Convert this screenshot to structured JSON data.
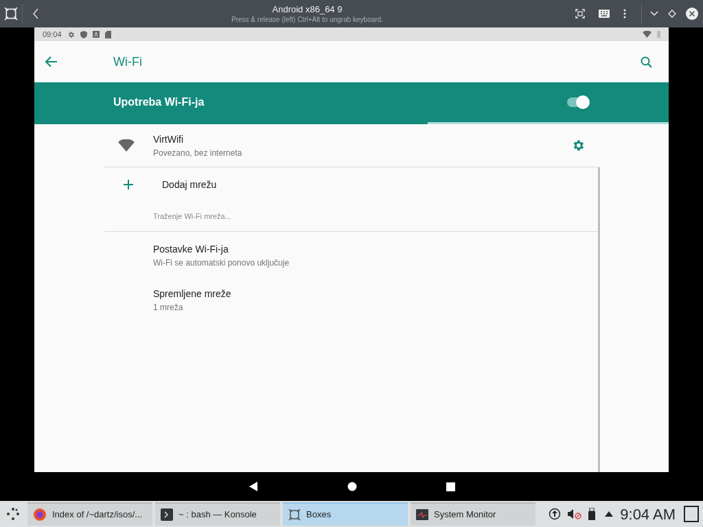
{
  "window": {
    "title": "Android x86_64 9",
    "subtitle": "Press & release (left) Ctrl+Alt to ungrab keyboard."
  },
  "status_bar": {
    "time": "09:04"
  },
  "app_bar": {
    "title": "Wi-Fi"
  },
  "master_switch": {
    "label": "Upotreba Wi-Fi-ja",
    "on": true,
    "level": 0.62
  },
  "networks": [
    {
      "name": "VirtWifi",
      "status": "Povezano, bez interneta"
    }
  ],
  "add_network": {
    "label": "Dodaj mrežu"
  },
  "scanning": "Traženje Wi-Fi mreža...",
  "settings_items": [
    {
      "title": "Postavke Wi-Fi-ja",
      "subtitle": "Wi-Fi se automatski ponovo uključuje"
    },
    {
      "title": "Spremljene mreže",
      "subtitle": "1 mreža"
    }
  ],
  "taskbar": {
    "tasks": [
      {
        "label": "Index of /~dartz/isos/...",
        "kind": "browser",
        "selected": false
      },
      {
        "label": "~ : bash — Konsole",
        "kind": "terminal",
        "selected": false
      },
      {
        "label": "Boxes",
        "kind": "boxes",
        "selected": true
      },
      {
        "label": "System Monitor",
        "kind": "monitor",
        "selected": false
      }
    ],
    "clock": "9:04 AM"
  }
}
